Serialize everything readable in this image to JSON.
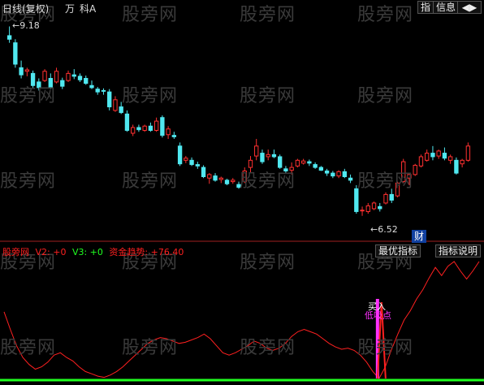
{
  "header": {
    "period_label": "日线(复权)",
    "unit_label": "万",
    "sub_label": "科A",
    "tab_index": "指",
    "tab_info": "信息",
    "nav_icon": "left-right-arrows-icon"
  },
  "watermark": "股旁网",
  "price_panel": {
    "max_label": "9.18",
    "min_label": "6.52",
    "badge": "财"
  },
  "indicator_panel": {
    "legend": [
      {
        "text": "股旁网",
        "color": "#ff2020"
      },
      {
        "text": "V2: +0",
        "color": "#ff2020"
      },
      {
        "text": "V3: +0",
        "color": "#20ff20"
      },
      {
        "text": "资金趋势: +76.40",
        "color": "#ff2020"
      }
    ],
    "btn_best": "最优指标",
    "btn_help": "指标说明",
    "buy_label": "买入",
    "low_label": "低吸点"
  },
  "colors": {
    "up": "#ff3030",
    "down": "#50e8f0",
    "trend": "#ff2020",
    "baseline": "#20ff20",
    "signal": "#ff30ff"
  },
  "chart_data": [
    {
      "type": "candlestick",
      "title": "",
      "ylim": [
        6.3,
        9.3
      ],
      "note": "each candle: [open, high, low, close]",
      "candles": [
        [
          9.05,
          9.18,
          8.95,
          9.0
        ],
        [
          8.95,
          9.0,
          8.6,
          8.65
        ],
        [
          8.6,
          8.7,
          8.45,
          8.5
        ],
        [
          8.55,
          8.6,
          8.48,
          8.57
        ],
        [
          8.52,
          8.56,
          8.32,
          8.35
        ],
        [
          8.4,
          8.45,
          8.28,
          8.32
        ],
        [
          8.42,
          8.58,
          8.4,
          8.55
        ],
        [
          8.45,
          8.52,
          8.3,
          8.33
        ],
        [
          8.4,
          8.6,
          8.38,
          8.55
        ],
        [
          8.42,
          8.46,
          8.3,
          8.34
        ],
        [
          8.42,
          8.56,
          8.4,
          8.52
        ],
        [
          8.5,
          8.58,
          8.44,
          8.48
        ],
        [
          8.48,
          8.52,
          8.4,
          8.43
        ],
        [
          8.45,
          8.49,
          8.36,
          8.38
        ],
        [
          8.35,
          8.42,
          8.3,
          8.32
        ],
        [
          8.3,
          8.33,
          8.22,
          8.26
        ],
        [
          8.28,
          8.31,
          8.22,
          8.27
        ],
        [
          8.26,
          8.3,
          8.0,
          8.05
        ],
        [
          8.0,
          8.2,
          7.98,
          8.15
        ],
        [
          8.05,
          8.12,
          7.95,
          7.97
        ],
        [
          7.95,
          8.0,
          7.7,
          7.72
        ],
        [
          7.68,
          7.8,
          7.64,
          7.76
        ],
        [
          7.76,
          7.8,
          7.7,
          7.73
        ],
        [
          7.72,
          7.8,
          7.7,
          7.78
        ],
        [
          7.78,
          7.83,
          7.7,
          7.72
        ],
        [
          7.72,
          7.9,
          7.7,
          7.85
        ],
        [
          7.9,
          7.93,
          7.62,
          7.65
        ],
        [
          7.66,
          7.78,
          7.6,
          7.74
        ],
        [
          7.65,
          7.7,
          7.6,
          7.63
        ],
        [
          7.5,
          7.55,
          7.22,
          7.25
        ],
        [
          7.3,
          7.36,
          7.26,
          7.33
        ],
        [
          7.3,
          7.34,
          7.22,
          7.24
        ],
        [
          7.24,
          7.28,
          7.18,
          7.22
        ],
        [
          7.2,
          7.23,
          7.05,
          7.07
        ],
        [
          7.05,
          7.12,
          6.97,
          7.1
        ],
        [
          7.08,
          7.12,
          7.0,
          7.02
        ],
        [
          7.03,
          7.07,
          6.98,
          7.05
        ],
        [
          7.02,
          7.04,
          6.95,
          6.97
        ],
        [
          7.0,
          7.05,
          6.97,
          7.02
        ],
        [
          6.96,
          7.0,
          6.9,
          6.92
        ],
        [
          7.0,
          7.2,
          6.98,
          7.15
        ],
        [
          7.2,
          7.36,
          7.12,
          7.3
        ],
        [
          7.36,
          7.6,
          7.3,
          7.5
        ],
        [
          7.4,
          7.45,
          7.25,
          7.28
        ],
        [
          7.35,
          7.45,
          7.3,
          7.38
        ],
        [
          7.38,
          7.45,
          7.33,
          7.35
        ],
        [
          7.35,
          7.38,
          7.18,
          7.2
        ],
        [
          7.18,
          7.22,
          7.12,
          7.15
        ],
        [
          7.16,
          7.27,
          7.1,
          7.2
        ],
        [
          7.22,
          7.32,
          7.2,
          7.3
        ],
        [
          7.26,
          7.32,
          7.24,
          7.29
        ],
        [
          7.28,
          7.31,
          7.22,
          7.26
        ],
        [
          7.24,
          7.27,
          7.18,
          7.2
        ],
        [
          7.2,
          7.22,
          7.15,
          7.16
        ],
        [
          7.15,
          7.18,
          7.08,
          7.12
        ],
        [
          7.12,
          7.15,
          7.05,
          7.08
        ],
        [
          7.08,
          7.16,
          7.05,
          7.14
        ],
        [
          7.14,
          7.18,
          7.05,
          7.07
        ],
        [
          7.05,
          7.1,
          6.98,
          7.02
        ],
        [
          6.9,
          6.95,
          6.55,
          6.58
        ],
        [
          6.6,
          6.65,
          6.52,
          6.6
        ],
        [
          6.58,
          6.7,
          6.55,
          6.66
        ],
        [
          6.62,
          6.72,
          6.6,
          6.7
        ],
        [
          6.65,
          6.7,
          6.58,
          6.62
        ],
        [
          6.7,
          6.85,
          6.68,
          6.82
        ],
        [
          6.82,
          6.9,
          6.7,
          6.74
        ],
        [
          6.8,
          7.0,
          6.78,
          6.98
        ],
        [
          7.0,
          7.32,
          6.98,
          7.28
        ],
        [
          7.05,
          7.12,
          6.95,
          7.1
        ],
        [
          7.1,
          7.25,
          7.08,
          7.23
        ],
        [
          7.22,
          7.38,
          7.2,
          7.35
        ],
        [
          7.3,
          7.45,
          7.28,
          7.4
        ],
        [
          7.4,
          7.5,
          7.3,
          7.35
        ],
        [
          7.36,
          7.45,
          7.32,
          7.43
        ],
        [
          7.4,
          7.48,
          7.3,
          7.33
        ],
        [
          7.3,
          7.38,
          7.25,
          7.35
        ],
        [
          7.3,
          7.34,
          7.1,
          7.12
        ],
        [
          7.25,
          7.32,
          7.2,
          7.3
        ],
        [
          7.3,
          7.55,
          7.28,
          7.5
        ]
      ]
    },
    {
      "type": "line",
      "title": "资金趋势",
      "ylim": [
        0,
        100
      ],
      "series": [
        {
          "name": "资金趋势",
          "values": [
            57,
            42,
            28,
            18,
            12,
            8,
            10,
            14,
            20,
            22,
            18,
            15,
            10,
            6,
            4,
            2,
            1,
            3,
            6,
            10,
            15,
            20,
            25,
            30,
            33,
            35,
            34,
            32,
            30,
            31,
            33,
            35,
            38,
            34,
            28,
            22,
            20,
            22,
            25,
            28,
            32,
            30,
            26,
            24,
            26,
            30,
            36,
            40,
            42,
            40,
            38,
            34,
            30,
            27,
            25,
            26,
            24,
            20,
            14,
            6,
            0,
            10,
            25,
            38,
            50,
            58,
            68,
            76,
            86,
            95,
            88,
            96,
            100,
            92,
            85,
            92,
            100
          ]
        }
      ],
      "baseline": 0,
      "signal_index": 60
    }
  ]
}
